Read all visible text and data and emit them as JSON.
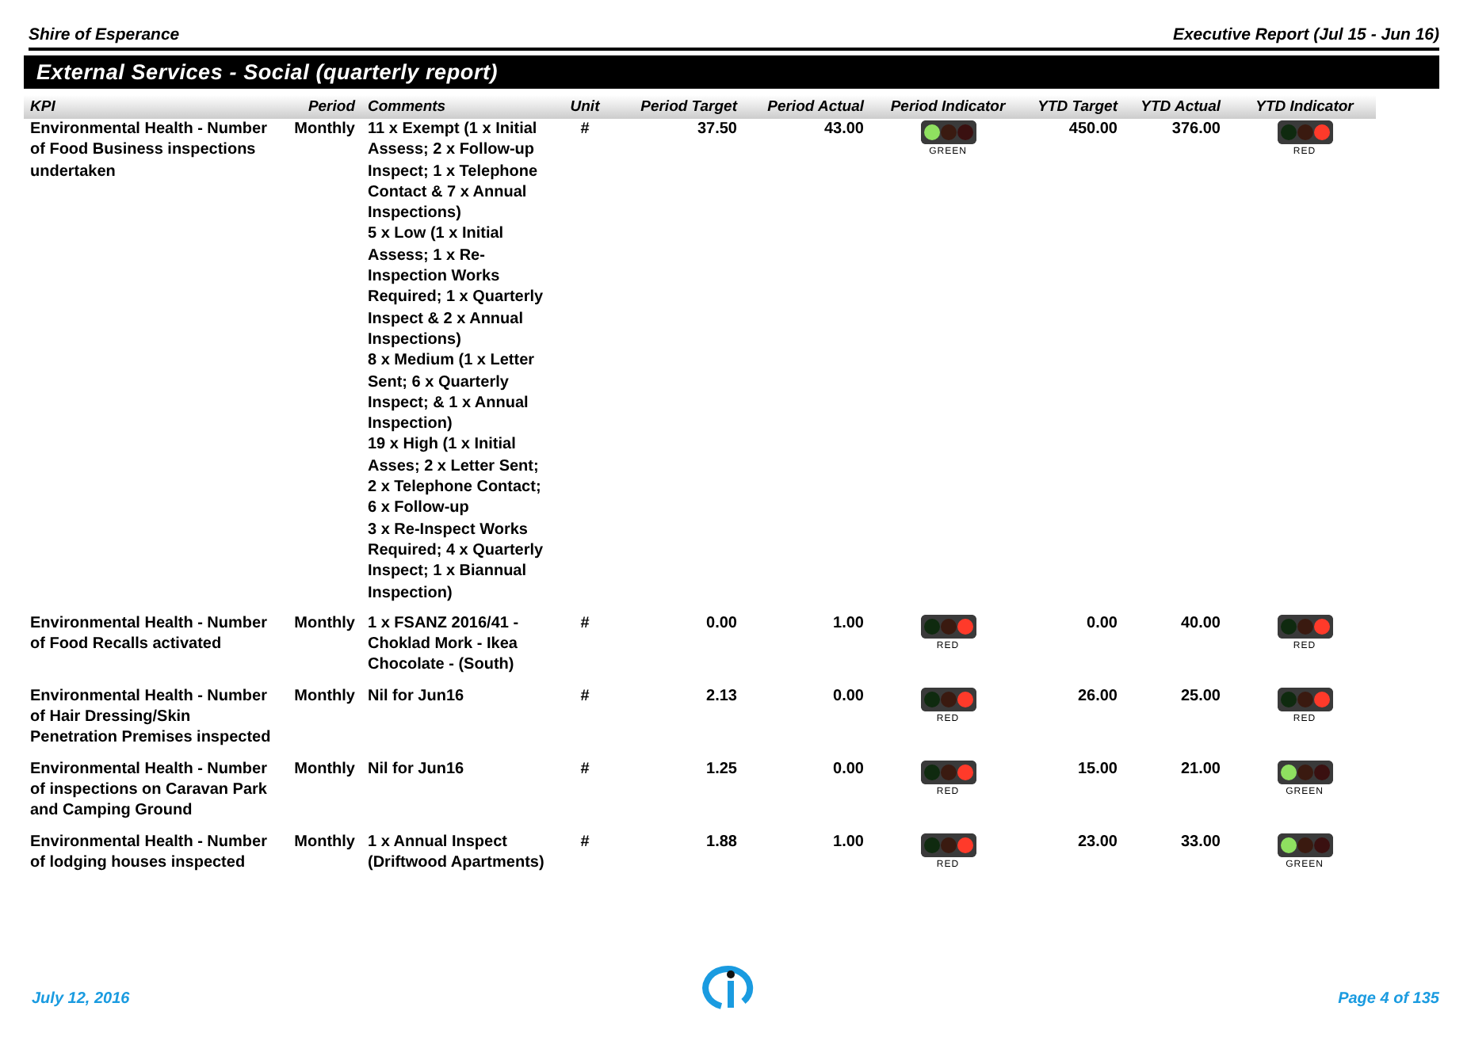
{
  "header": {
    "organisation": "Shire of Esperance",
    "report": "Executive Report (Jul 15 - Jun 16)"
  },
  "section_title": "External Services - Social (quarterly report)",
  "table": {
    "columns": [
      "KPI",
      "Period",
      "Comments",
      "Unit",
      "Period Target",
      "Period Actual",
      "Period Indicator",
      "YTD Target",
      "YTD Actual",
      "YTD Indicator"
    ],
    "rows": [
      {
        "kpi": "Environmental Health - Number of Food Business inspections undertaken",
        "period": "Monthly",
        "comments": [
          "11 x Exempt (1 x Initial Assess; 2 x Follow-up Inspect; 1 x Telephone Contact & 7 x Annual Inspections)",
          "5 x Low (1 x Initial Assess;  1 x Re-Inspection Works Required; 1 x Quarterly Inspect & 2 x Annual Inspections)",
          "8 x Medium (1 x Letter Sent; 6 x Quarterly Inspect; & 1 x Annual Inspection)",
          "19 x High (1 x Initial Asses; 2 x Letter Sent; 2 x Telephone Contact; 6 x Follow-up",
          "3 x Re-Inspect Works Required; 4 x Quarterly Inspect; 1 x Biannual Inspection)"
        ],
        "unit": "#",
        "period_target": "37.50",
        "period_actual": "43.00",
        "period_indicator": {
          "kind": "green",
          "label": "GREEN"
        },
        "ytd_target": "450.00",
        "ytd_actual": "376.00",
        "ytd_indicator": {
          "kind": "red",
          "label": "RED"
        }
      },
      {
        "kpi": "Environmental Health - Number of Food Recalls activated",
        "period": "Monthly",
        "comments": [
          "1 x FSANZ 2016/41 - Choklad Mork - Ikea Chocolate - (South)"
        ],
        "unit": "#",
        "period_target": "0.00",
        "period_actual": "1.00",
        "period_indicator": {
          "kind": "red",
          "label": "RED"
        },
        "ytd_target": "0.00",
        "ytd_actual": "40.00",
        "ytd_indicator": {
          "kind": "red",
          "label": "RED"
        }
      },
      {
        "kpi": "Environmental Health - Number of Hair Dressing/Skin Penetration Premises inspected",
        "period": "Monthly",
        "comments": [
          "Nil for Jun16"
        ],
        "unit": "#",
        "period_target": "2.13",
        "period_actual": "0.00",
        "period_indicator": {
          "kind": "red",
          "label": "RED"
        },
        "ytd_target": "26.00",
        "ytd_actual": "25.00",
        "ytd_indicator": {
          "kind": "red",
          "label": "RED"
        }
      },
      {
        "kpi": "Environmental Health - Number of inspections on Caravan Park and Camping Ground",
        "period": "Monthly",
        "comments": [
          "Nil for Jun16"
        ],
        "unit": "#",
        "period_target": "1.25",
        "period_actual": "0.00",
        "period_indicator": {
          "kind": "red",
          "label": "RED"
        },
        "ytd_target": "15.00",
        "ytd_actual": "21.00",
        "ytd_indicator": {
          "kind": "green",
          "label": "GREEN"
        }
      },
      {
        "kpi": "Environmental Health - Number of lodging houses inspected",
        "period": "Monthly",
        "comments": [
          "1 x Annual Inspect (Driftwood Apartments)"
        ],
        "unit": "#",
        "period_target": "1.88",
        "period_actual": "1.00",
        "period_indicator": {
          "kind": "red",
          "label": "RED"
        },
        "ytd_target": "23.00",
        "ytd_actual": "33.00",
        "ytd_indicator": {
          "kind": "green",
          "label": "GREEN"
        }
      }
    ]
  },
  "footer": {
    "date": "July 12, 2016",
    "page": "Page 4 of 135"
  }
}
